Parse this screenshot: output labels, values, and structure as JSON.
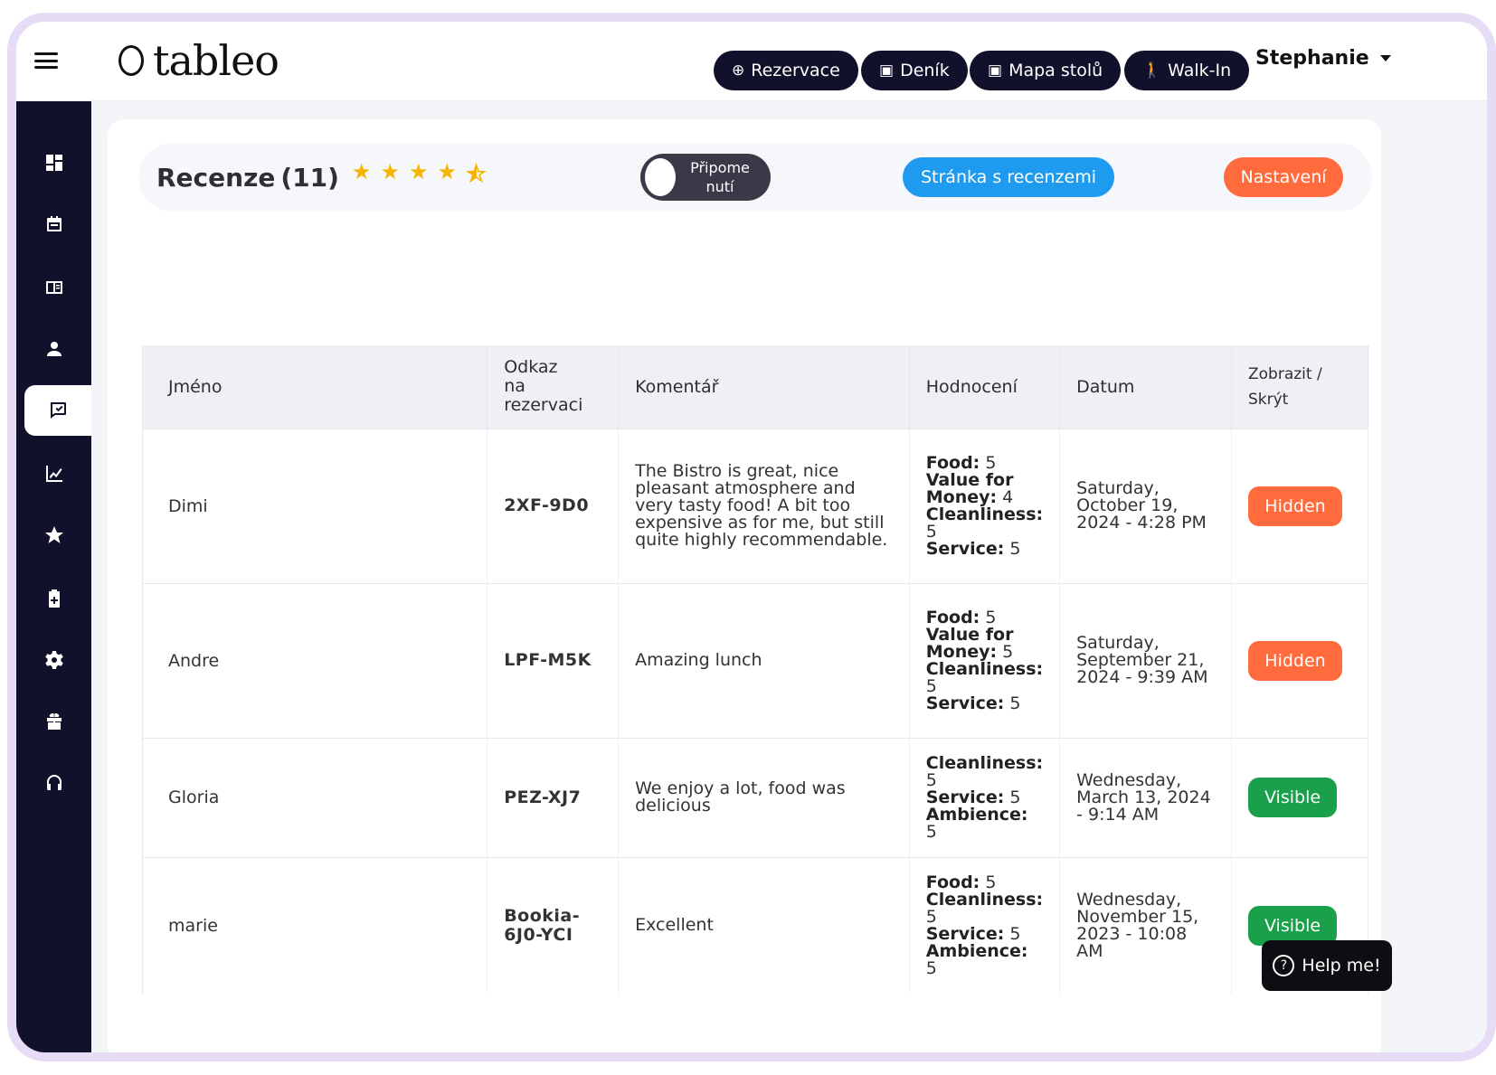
{
  "app": {
    "logo_text": "tableo"
  },
  "topbar": {
    "buttons": [
      {
        "icon": "plus-circle-icon",
        "label": "Rezervace"
      },
      {
        "icon": "calendar-icon",
        "label": "Deník"
      },
      {
        "icon": "calendar-icon",
        "label": "Mapa stolů"
      },
      {
        "icon": "walking-person-icon",
        "label": "Walk-In"
      }
    ],
    "user_name": "Stephanie"
  },
  "sidebar": {
    "items": [
      {
        "icon": "dashboard-icon"
      },
      {
        "icon": "calendar-icon"
      },
      {
        "icon": "book-icon"
      },
      {
        "icon": "person-icon"
      },
      {
        "icon": "review-icon",
        "active": true
      },
      {
        "icon": "chart-icon"
      },
      {
        "icon": "star-icon"
      },
      {
        "icon": "battery-icon"
      },
      {
        "icon": "gear-icon"
      },
      {
        "icon": "gift-icon"
      },
      {
        "icon": "headset-icon"
      }
    ]
  },
  "reviews": {
    "title": "Recenze",
    "count": "(11)",
    "toggle_label_line1": "Připome",
    "toggle_label_line2": "nutí",
    "review_page_button": "Stránka s recenzemi",
    "settings_button": "Nastavení"
  },
  "table": {
    "headers": {
      "name": "Jméno",
      "link_line1": "Odkaz",
      "link_line2": "na rezervaci",
      "comment": "Komentář",
      "rating": "Hodnocení",
      "date": "Datum",
      "toggle_line1": "Zobrazit /",
      "toggle_line2": "Skrýt"
    },
    "rows": [
      {
        "name": "Dimi",
        "link": "2XF-9D0",
        "comment": "The Bistro is great, nice pleasant atmosphere and very tasty food! A bit too expensive as for me, but still quite highly recommendable.",
        "ratings": [
          {
            "label": "Food:",
            "value": "5"
          },
          {
            "label": "Value for Money:",
            "value": "4"
          },
          {
            "label": "Cleanliness:",
            "value": "5"
          },
          {
            "label": "Service:",
            "value": "5"
          }
        ],
        "date": "Saturday, October 19, 2024 - 4:28 PM",
        "status": "Hidden"
      },
      {
        "name": "Andre",
        "link": "LPF-M5K",
        "comment": "Amazing lunch",
        "ratings": [
          {
            "label": "Food:",
            "value": "5"
          },
          {
            "label": "Value for Money:",
            "value": "5"
          },
          {
            "label": "Cleanliness:",
            "value": "5"
          },
          {
            "label": "Service:",
            "value": "5"
          }
        ],
        "date": "Saturday, September 21, 2024 - 9:39 AM",
        "status": "Hidden"
      },
      {
        "name": "Gloria",
        "link": "PEZ-XJ7",
        "comment": "We enjoy a lot, food was delicious",
        "ratings": [
          {
            "label": "Cleanliness:",
            "value": "5"
          },
          {
            "label": "Service:",
            "value": "5"
          },
          {
            "label": "Ambience:",
            "value": "5"
          }
        ],
        "date": "Wednesday, March 13, 2024 - 9:14 AM",
        "status": "Visible"
      },
      {
        "name": "marie",
        "link": "Bookia-6J0-YCI",
        "comment": "Excellent",
        "ratings": [
          {
            "label": "Food:",
            "value": "5"
          },
          {
            "label": "Cleanliness:",
            "value": "5"
          },
          {
            "label": "Service:",
            "value": "5"
          },
          {
            "label": "Ambience:",
            "value": "5"
          }
        ],
        "date": "Wednesday, November 15, 2023 - 10:08 AM",
        "status": "Visible"
      }
    ]
  },
  "help": {
    "label": "Help me!"
  },
  "colors": {
    "dark": "#12112b",
    "blue": "#1e9bef",
    "orange": "#ff6b3d",
    "green": "#1aa04a",
    "star": "#f5b400"
  }
}
